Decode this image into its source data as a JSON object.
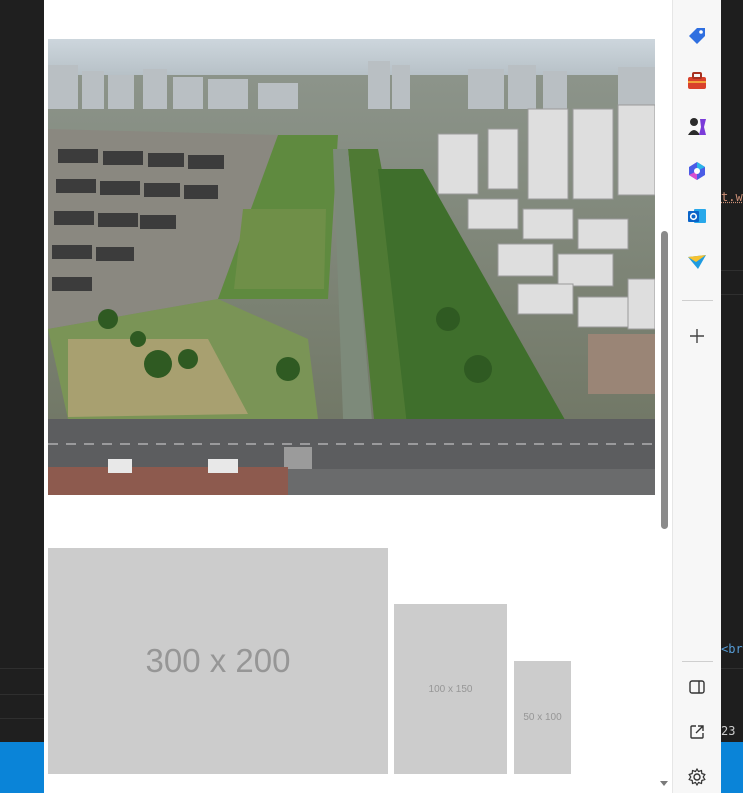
{
  "browser_page": {
    "photo": {
      "alt": "aerial view"
    },
    "placeholders": [
      {
        "label": "300 x 200"
      },
      {
        "label": "100 x 150"
      },
      {
        "label": "50 x 100"
      }
    ]
  },
  "edge_sidebar": {
    "items": [
      {
        "icon": "shopping-tag-icon",
        "color": "#2f6fe0"
      },
      {
        "icon": "toolbox-icon",
        "color": "#d9412b"
      },
      {
        "icon": "games-icon",
        "color": "#7a3bd9"
      },
      {
        "icon": "copilot-icon",
        "color": "#4a5ce6"
      },
      {
        "icon": "outlook-icon",
        "color": "#0a64c8"
      },
      {
        "icon": "send-icon",
        "color": "#1f9be0"
      },
      {
        "icon": "add-icon"
      },
      {
        "icon": "split-screen-icon"
      },
      {
        "icon": "open-external-icon"
      },
      {
        "icon": "settings-icon"
      }
    ]
  },
  "editor_background": {
    "fragment_1": "t.w",
    "fragment_2": "<br",
    "fragment_3": "23"
  },
  "colors": {
    "editor_bg": "#1e1e1e",
    "status_bar": "#0a84d8",
    "placeholder_fill": "#cccccc",
    "placeholder_text": "#969696"
  }
}
